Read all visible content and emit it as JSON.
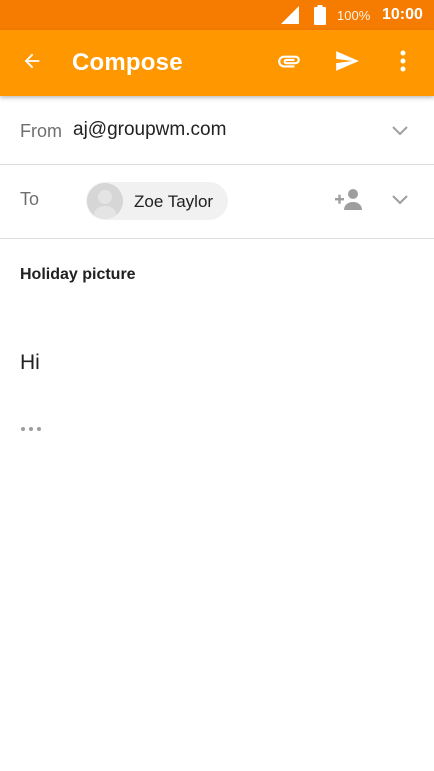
{
  "status_bar": {
    "battery": "100%",
    "time": "10:00",
    "icons": [
      "signal-icon",
      "battery-icon"
    ]
  },
  "app_bar": {
    "title": "Compose",
    "icons": [
      "back-arrow-icon",
      "paperclip-icon",
      "send-icon",
      "more-vert-icon"
    ]
  },
  "from": {
    "label": "From",
    "value": "aj@groupwm.com"
  },
  "to": {
    "label": "To",
    "recipients": [
      {
        "name": "Zoe Taylor"
      }
    ]
  },
  "subject": "Holiday picture",
  "body": "Hi",
  "colors": {
    "status_bar": "#f57c00",
    "app_bar": "#ff9800",
    "text_primary": "#212121",
    "text_secondary": "#6f6f6f"
  }
}
